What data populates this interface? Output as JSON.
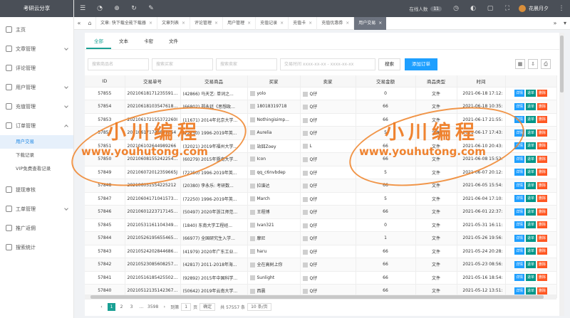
{
  "app": {
    "title": "考研云分享"
  },
  "sidebar": {
    "items": [
      {
        "label": "主页",
        "icon": "home-icon"
      },
      {
        "label": "文章管理",
        "icon": "doc-icon",
        "caret": true
      },
      {
        "label": "评论管理",
        "icon": "comment-icon"
      },
      {
        "label": "用户管理",
        "icon": "user-icon",
        "caret": true
      },
      {
        "label": "充值管理",
        "icon": "wallet-icon",
        "caret": true
      },
      {
        "label": "订单管理",
        "icon": "order-icon",
        "caret": true,
        "open": true
      }
    ],
    "sub_items": [
      {
        "label": "用户交易",
        "active": true
      },
      {
        "label": "下载记录"
      },
      {
        "label": "VIP免费查看记录"
      }
    ],
    "items2": [
      {
        "label": "提现审核",
        "icon": "withdraw-icon"
      },
      {
        "label": "工单管理",
        "icon": "ticket-icon",
        "caret": true
      },
      {
        "label": "推广返佣",
        "icon": "promo-icon"
      },
      {
        "label": "搜索统计",
        "icon": "search-icon"
      }
    ]
  },
  "topbar": {
    "online_label": "在线人数",
    "online_count": "11",
    "user_name": "花晨月夕"
  },
  "tabs": [
    {
      "label": "文章: 快下载全能下载器"
    },
    {
      "label": "文章列表"
    },
    {
      "label": "评论管理"
    },
    {
      "label": "用户管理"
    },
    {
      "label": "充值记录"
    },
    {
      "label": "充值卡"
    },
    {
      "label": "充值优惠券"
    },
    {
      "label": "用户交易",
      "active": true
    }
  ],
  "subtabs": [
    "全部",
    "文本",
    "卡密",
    "文件"
  ],
  "filters": {
    "goods_name": "搜索商品名",
    "buyer": "搜索买家",
    "seller": "搜索卖家",
    "time": "交易时间 xxxx-xx-xx - xxxx-xx-xx",
    "search_btn": "搜索",
    "add_btn": "添加订单"
  },
  "table": {
    "headers": [
      "ID",
      "交易单号",
      "交易商品",
      "买家",
      "卖家",
      "交易金额",
      "商品类型",
      "时间"
    ],
    "ops": {
      "detail": "详情",
      "refund": "退单",
      "delete": "删除"
    },
    "rows": [
      [
        "57855",
        "202106181712355919O",
        "(42866) 马天艺: 单词之...",
        "yolo",
        "Q仔",
        "0",
        "文件",
        "2021-06-18 17:12:"
      ],
      [
        "57854",
        "202106181035476189T",
        "(66802) 郑永廷《思想政...",
        "18018319718",
        "Q仔",
        "66",
        "文件",
        "2021-06-18 10:35:"
      ],
      [
        "57853",
        "202106172155372260I",
        "(11671) 2014年北京大学...",
        "Nothingisimp...",
        "Q仔",
        "66",
        "文件",
        "2021-06-17 21:55:"
      ],
      [
        "57852",
        "202106171743843254",
        "(72250) 1996-2019年英...",
        "Aurelia",
        "Q仔",
        "5",
        "文件",
        "2021-06-17 17:43:"
      ],
      [
        "57851",
        "202106102644989266",
        "(32021) 2019年福州大学...",
        "站囧Zoey",
        "L",
        "66",
        "文件",
        "2021-06-10 20:43:"
      ],
      [
        "57850",
        "202106081552422544O",
        "(60279) 2015年暨南大学...",
        "Icon",
        "Q仔",
        "66",
        "文件",
        "2021-06-08 15:52:"
      ],
      [
        "57849",
        "202106072012359665J",
        "(72250) 1996-2019年英...",
        "qq_c6nvbdep",
        "Q仔",
        "5",
        "文件",
        "2021-06-07 20:12:"
      ],
      [
        "57848",
        "202106051554225212",
        "(20380) 李永乐: 考研数...",
        "拉谱达",
        "Q仔",
        "66",
        "文件",
        "2021-06-05 15:54:"
      ],
      [
        "57847",
        "202106041710415738O",
        "(72250) 1996-2019年英...",
        "March",
        "Q仔",
        "5",
        "文件",
        "2021-06-04 17:10:"
      ],
      [
        "57846",
        "202106012237171456O",
        "(50497) 2020年浙江师范...",
        "王程博",
        "Q仔",
        "66",
        "文件",
        "2021-06-01 22:37:"
      ],
      [
        "57845",
        "202105311611043492O",
        "(1840) 东南大学工程经...",
        "Ivan321",
        "Q仔",
        "0",
        "文件",
        "2021-05-31 16:11:"
      ],
      [
        "57844",
        "202105261956554653S",
        "(66977) 全国研究生入学...",
        "摩尼",
        "Q仔",
        "1",
        "文件",
        "2021-05-26 19:56:"
      ],
      [
        "57843",
        "202105242028446863S",
        "(41979) 2020年广东工业...",
        "haru",
        "Q仔",
        "66",
        "文件",
        "2021-05-24 20:28:"
      ],
      [
        "57842",
        "202105230856082570B",
        "(42817) 2011-2018年海...",
        "全在高树上你",
        "Q仔",
        "66",
        "文件",
        "2021-05-23 08:56:"
      ],
      [
        "57841",
        "202105161854255027S",
        "(92892) 2015年中国科学...",
        "Sunlight",
        "Q仔",
        "66",
        "文件",
        "2021-05-16 18:54:"
      ],
      [
        "57840",
        "202105121351423672E",
        "(50642) 2019年云南大学...",
        "西晨",
        "Q仔",
        "66",
        "文件",
        "2021-05-12 13:51:"
      ]
    ]
  },
  "pager": {
    "pages": [
      "1",
      "2",
      "3",
      "...",
      "3598"
    ],
    "goto_label": "到第",
    "goto_value": "1",
    "page_label": "页",
    "confirm": "确定",
    "total": "共 57557 条",
    "per_page": "10 条/页"
  },
  "watermark": {
    "text1": "小川编程",
    "text2": "www.youhutong.com"
  }
}
